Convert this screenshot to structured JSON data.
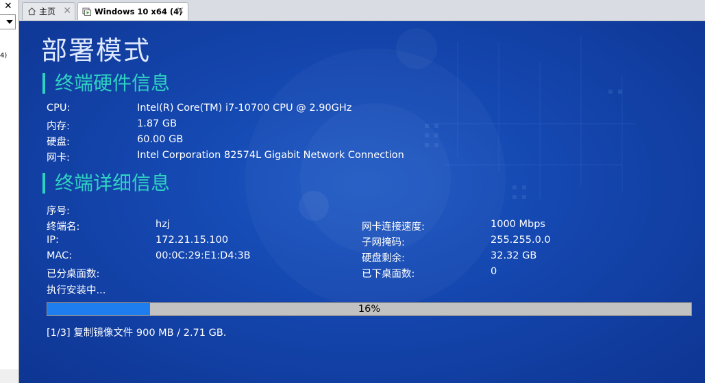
{
  "left_panel": {
    "close_glyph": "✕",
    "fragment": "4)"
  },
  "tabs": [
    {
      "label": "主页",
      "icon": "home-icon"
    },
    {
      "label": "Windows 10 x64 (4)",
      "icon": "vm-running-icon"
    }
  ],
  "page": {
    "title": "部署模式",
    "hardware": {
      "heading": "终端硬件信息",
      "rows": [
        {
          "label": "CPU:",
          "value": "Intel(R) Core(TM) i7-10700 CPU @ 2.90GHz"
        },
        {
          "label": "内存:",
          "value": "1.87 GB"
        },
        {
          "label": "硬盘:",
          "value": "60.00 GB"
        },
        {
          "label": "网卡:",
          "value": "Intel Corporation 82574L Gigabit Network Connection"
        }
      ]
    },
    "details": {
      "heading": "终端详细信息",
      "left": [
        {
          "label": "序号:",
          "value": ""
        },
        {
          "label": "终端名:",
          "value": "hzj"
        },
        {
          "label": "IP:",
          "value": "172.21.15.100"
        },
        {
          "label": "MAC:",
          "value": "00:0C:29:E1:D4:3B"
        },
        {
          "label": "已分桌面数:",
          "value": ""
        }
      ],
      "right": [
        {
          "label": "网卡连接速度:",
          "value": "1000 Mbps"
        },
        {
          "label": "子网掩码:",
          "value": "255.255.0.0"
        },
        {
          "label": "硬盘剩余:",
          "value": "32.32 GB"
        },
        {
          "label": "已下桌面数:",
          "value": "0"
        }
      ]
    },
    "status": "执行安装中...",
    "progress": {
      "percent_label": "16%",
      "value": 0.16
    },
    "copy_status": "[1/3] 复制镜像文件 900 MB / 2.71 GB."
  },
  "colors": {
    "background": "#1446ae",
    "accent": "#2fd1c3",
    "progress_fill": "#1e7ef0"
  }
}
